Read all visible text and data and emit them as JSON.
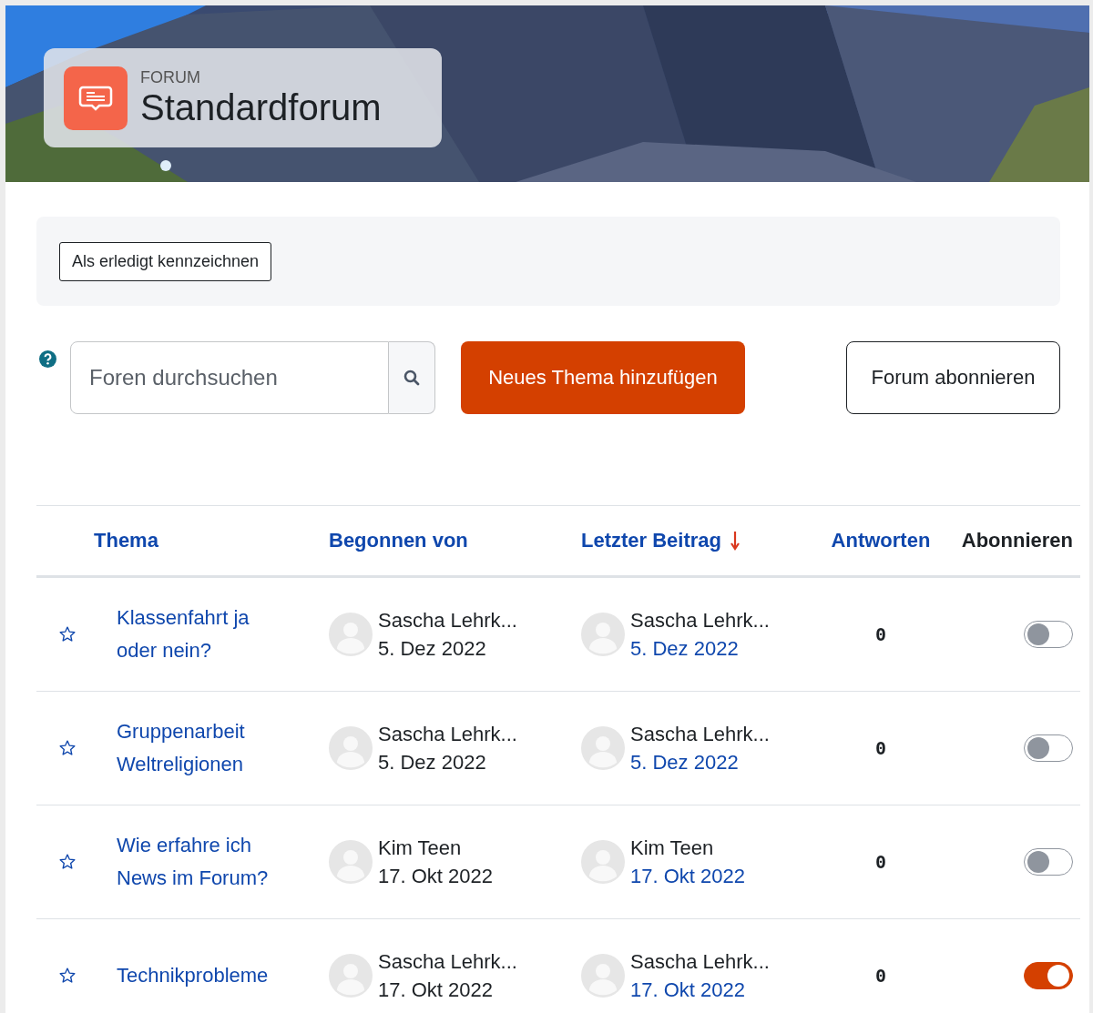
{
  "header": {
    "kind": "picture",
    "activity_type": "FORUM",
    "title": "Standardforum"
  },
  "action_bar": {
    "button": "Als erledigt kennzeichnen"
  },
  "toolbar": {
    "search": {
      "placeholder": "Foren durchsuchen"
    },
    "add_button": "Neues Thema hinzufügen",
    "subscribe_button": "Forum abonnieren"
  },
  "table": {
    "columns": [
      {
        "label": "Thema",
        "sorted": false
      },
      {
        "label": "Begonnen von",
        "sorted": false
      },
      {
        "label": "Letzter Beitrag",
        "sorted": true
      },
      {
        "label": "Antworten",
        "sorted": false
      },
      {
        "label": "Abonnieren",
        "sorted": false
      }
    ],
    "rows": [
      {
        "starred": false,
        "topic": "Klassenfahrt ja oder nein?",
        "started_by": "Sascha Lehrk...",
        "started_date": "5. Dez 2022",
        "last_by": "Sascha Lehrk...",
        "last_date": "5. Dez 2022",
        "replies": "0",
        "subscribed": false
      },
      {
        "starred": false,
        "topic": "Gruppenarbeit Weltreligionen",
        "started_by": "Sascha Lehrk...",
        "started_date": "5. Dez 2022",
        "last_by": "Sascha Lehrk...",
        "last_date": "5. Dez 2022",
        "replies": "0",
        "subscribed": false
      },
      {
        "starred": false,
        "topic": "Wie erfahre ich News im Forum?",
        "started_by": "Kim Teen",
        "started_date": "17. Okt 2022",
        "last_by": "Kim Teen",
        "last_date": "17. Okt 2022",
        "replies": "0",
        "subscribed": false
      },
      {
        "starred": false,
        "topic": "Technikprobleme",
        "started_by": "Sascha Lehrk...",
        "started_date": "17. Okt 2022",
        "last_by": "Sascha Lehrk...",
        "last_date": "17. Okt 2022",
        "replies": "0",
        "subscribed": true
      }
    ]
  }
}
